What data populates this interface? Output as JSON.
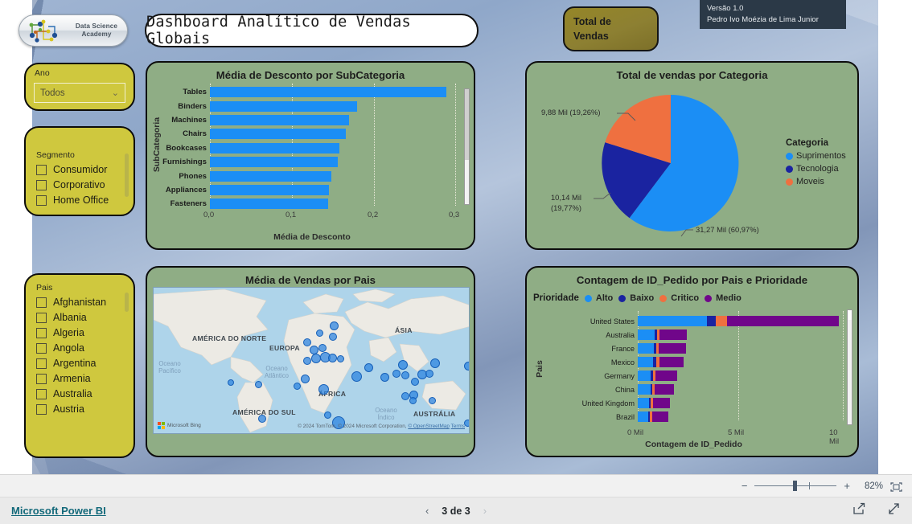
{
  "header": {
    "logo_line1": "Data Science",
    "logo_line2": "Academy",
    "title": "Dashboard Analítico de Vendas Globais",
    "kpi_line1": "Total de",
    "kpi_line2": "Vendas",
    "version": "Versão 1.0",
    "author": "Pedro Ivo Moézia de Lima Junior"
  },
  "slicers": {
    "ano": {
      "label": "Ano",
      "value": "Todos",
      "chevron": "chevron-down"
    },
    "segmento": {
      "label": "Segmento",
      "items": [
        "Consumidor",
        "Corporativo",
        "Home Office"
      ]
    },
    "pais": {
      "label": "Pais",
      "items": [
        "Afghanistan",
        "Albania",
        "Algeria",
        "Angola",
        "Argentina",
        "Armenia",
        "Australia",
        "Austria"
      ]
    }
  },
  "chart_data": [
    {
      "type": "bar",
      "orientation": "horizontal",
      "title": "Média de Desconto por SubCategoria",
      "xlabel": "Média de Desconto",
      "ylabel": "SubCategoria",
      "categories": [
        "Tables",
        "Binders",
        "Machines",
        "Chairs",
        "Bookcases",
        "Furnishings",
        "Phones",
        "Appliances",
        "Fasteners"
      ],
      "values": [
        0.288,
        0.179,
        0.17,
        0.166,
        0.158,
        0.156,
        0.148,
        0.145,
        0.144
      ],
      "xticks": [
        "0,0",
        "0,1",
        "0,2",
        "0,3"
      ],
      "xlim": [
        0,
        0.3
      ],
      "color": "#1b8ef5",
      "grid": true,
      "scrollable": true
    },
    {
      "type": "pie",
      "title": "Total de vendas por Categoria",
      "legend_title": "Categoria",
      "legend_position": "right",
      "labels": [
        "Suprimentos",
        "Tecnologia",
        "Moveis"
      ],
      "values": [
        31270,
        10140,
        9880
      ],
      "percents": [
        "60,97%",
        "19,77%",
        "19,26%"
      ],
      "annotations": [
        "31,27 Mil (60,97%)",
        "10,14 Mil (19,77%)",
        "9,88 Mil (19,26%)"
      ],
      "colors": [
        "#1b8ef5",
        "#1a23a0",
        "#ef7040"
      ]
    },
    {
      "type": "scatter",
      "subtype": "bubble-map",
      "title": "Média de Vendas por Pais",
      "map_labels": [
        "AMÉRICA DO NORTE",
        "EUROPA",
        "ÁSIA",
        "ÁFRICA",
        "AMÉRICA DO SUL",
        "AUSTRÁLIA"
      ],
      "ocean_labels": [
        "Oceano Pacífico",
        "Oceano Atlântico",
        "Oceano Índico"
      ],
      "provider": "Microsoft Bing",
      "credit": "© 2024 TomTom, © 2024 Microsoft Corporation,",
      "credit_link1": "© OpenStreetMap",
      "credit_link2": "Terms",
      "bubble_color": "#2882e1"
    },
    {
      "type": "bar",
      "subtype": "stacked",
      "orientation": "horizontal",
      "title": "Contagem de ID_Pedido por Pais e Prioridade",
      "xlabel": "Contagem de ID_Pedido",
      "ylabel": "Pais",
      "legend_title": "Prioridade",
      "legend": [
        "Alto",
        "Baixo",
        "Critico",
        "Medio"
      ],
      "legend_colors": [
        "#1b8ef5",
        "#1a23a0",
        "#ef7040",
        " #7b0f8f"
      ],
      "series_colors": [
        "#1b8ef5",
        "#1a23a0",
        "#ef7040",
        "#70068a"
      ],
      "categories": [
        "United States",
        "Australia",
        "France",
        "Mexico",
        "Germany",
        "China",
        "United Kingdom",
        "Brazil"
      ],
      "series": [
        {
          "name": "Alto",
          "values": [
            3430,
            830,
            790,
            760,
            640,
            640,
            560,
            530
          ]
        },
        {
          "name": "Baixo",
          "values": [
            450,
            120,
            130,
            140,
            100,
            90,
            80,
            70
          ]
        },
        {
          "name": "Critico",
          "values": [
            560,
            130,
            130,
            140,
            110,
            100,
            100,
            110
          ]
        },
        {
          "name": "Medio",
          "values": [
            5560,
            1370,
            1340,
            1200,
            1080,
            950,
            820,
            790
          ]
        }
      ],
      "xticks": [
        "0 Mil",
        "5 Mil",
        "10 Mil"
      ],
      "xlim": [
        0,
        10000
      ],
      "scrollable": true
    }
  ],
  "statusbar": {
    "zoom_out": "−",
    "zoom_in": "+",
    "zoom_level": "82%",
    "fit_icon": "fit-to-page-icon"
  },
  "footer": {
    "brand": "Microsoft Power BI",
    "prev_icon": "chevron-left",
    "next_icon": "chevron-right",
    "page_text": "3 de 3",
    "share_icon": "share-icon",
    "fullscreen_icon": "fullscreen-icon"
  }
}
